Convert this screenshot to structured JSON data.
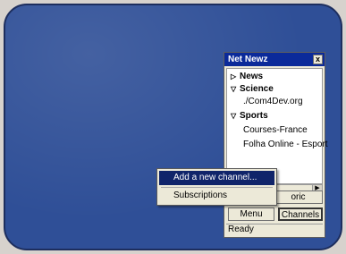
{
  "window": {
    "title": "Net Newz",
    "close_label": "x"
  },
  "tree": {
    "items": [
      {
        "label": "News",
        "type": "category",
        "state": "collapsed"
      },
      {
        "label": "Science",
        "type": "category",
        "state": "expanded"
      },
      {
        "label": "./Com4Dev.org",
        "type": "channel"
      },
      {
        "label": "Sports",
        "type": "category",
        "state": "expanded"
      },
      {
        "label": "Courses-France",
        "type": "channel"
      },
      {
        "label": "Folha Online - Esport",
        "type": "channel"
      }
    ]
  },
  "buttons": {
    "historic": "oric",
    "menu": "Menu",
    "channels": "Channels"
  },
  "status": "Ready",
  "context_menu": {
    "items": [
      {
        "label": "Add a new channel...",
        "selected": true
      },
      {
        "label": "Subscriptions",
        "selected": false
      }
    ]
  }
}
